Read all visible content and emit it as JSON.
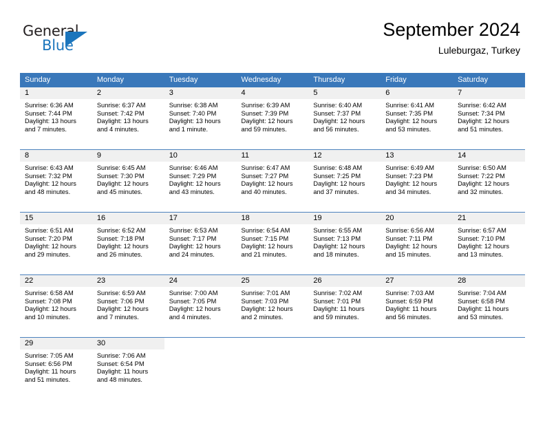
{
  "brand": {
    "name_part1": "General",
    "name_part2": "Blue",
    "logo_icon": "triangle-flag-icon",
    "color_primary": "#1b75bc",
    "color_text": "#231f20"
  },
  "header": {
    "title": "September 2024",
    "subtitle": "Luleburgaz, Turkey"
  },
  "theme": {
    "header_row_bg": "#3a78ba",
    "daynum_bar_bg": "#f0f0f0",
    "week_separator": "#4a81bd",
    "page_bg": "#ffffff"
  },
  "weekday_headers": [
    "Sunday",
    "Monday",
    "Tuesday",
    "Wednesday",
    "Thursday",
    "Friday",
    "Saturday"
  ],
  "weeks": [
    [
      {
        "day": "1",
        "sunrise": "Sunrise: 6:36 AM",
        "sunset": "Sunset: 7:44 PM",
        "daylight_line1": "Daylight: 13 hours",
        "daylight_line2": "and 7 minutes."
      },
      {
        "day": "2",
        "sunrise": "Sunrise: 6:37 AM",
        "sunset": "Sunset: 7:42 PM",
        "daylight_line1": "Daylight: 13 hours",
        "daylight_line2": "and 4 minutes."
      },
      {
        "day": "3",
        "sunrise": "Sunrise: 6:38 AM",
        "sunset": "Sunset: 7:40 PM",
        "daylight_line1": "Daylight: 13 hours",
        "daylight_line2": "and 1 minute."
      },
      {
        "day": "4",
        "sunrise": "Sunrise: 6:39 AM",
        "sunset": "Sunset: 7:39 PM",
        "daylight_line1": "Daylight: 12 hours",
        "daylight_line2": "and 59 minutes."
      },
      {
        "day": "5",
        "sunrise": "Sunrise: 6:40 AM",
        "sunset": "Sunset: 7:37 PM",
        "daylight_line1": "Daylight: 12 hours",
        "daylight_line2": "and 56 minutes."
      },
      {
        "day": "6",
        "sunrise": "Sunrise: 6:41 AM",
        "sunset": "Sunset: 7:35 PM",
        "daylight_line1": "Daylight: 12 hours",
        "daylight_line2": "and 53 minutes."
      },
      {
        "day": "7",
        "sunrise": "Sunrise: 6:42 AM",
        "sunset": "Sunset: 7:34 PM",
        "daylight_line1": "Daylight: 12 hours",
        "daylight_line2": "and 51 minutes."
      }
    ],
    [
      {
        "day": "8",
        "sunrise": "Sunrise: 6:43 AM",
        "sunset": "Sunset: 7:32 PM",
        "daylight_line1": "Daylight: 12 hours",
        "daylight_line2": "and 48 minutes."
      },
      {
        "day": "9",
        "sunrise": "Sunrise: 6:45 AM",
        "sunset": "Sunset: 7:30 PM",
        "daylight_line1": "Daylight: 12 hours",
        "daylight_line2": "and 45 minutes."
      },
      {
        "day": "10",
        "sunrise": "Sunrise: 6:46 AM",
        "sunset": "Sunset: 7:29 PM",
        "daylight_line1": "Daylight: 12 hours",
        "daylight_line2": "and 43 minutes."
      },
      {
        "day": "11",
        "sunrise": "Sunrise: 6:47 AM",
        "sunset": "Sunset: 7:27 PM",
        "daylight_line1": "Daylight: 12 hours",
        "daylight_line2": "and 40 minutes."
      },
      {
        "day": "12",
        "sunrise": "Sunrise: 6:48 AM",
        "sunset": "Sunset: 7:25 PM",
        "daylight_line1": "Daylight: 12 hours",
        "daylight_line2": "and 37 minutes."
      },
      {
        "day": "13",
        "sunrise": "Sunrise: 6:49 AM",
        "sunset": "Sunset: 7:23 PM",
        "daylight_line1": "Daylight: 12 hours",
        "daylight_line2": "and 34 minutes."
      },
      {
        "day": "14",
        "sunrise": "Sunrise: 6:50 AM",
        "sunset": "Sunset: 7:22 PM",
        "daylight_line1": "Daylight: 12 hours",
        "daylight_line2": "and 32 minutes."
      }
    ],
    [
      {
        "day": "15",
        "sunrise": "Sunrise: 6:51 AM",
        "sunset": "Sunset: 7:20 PM",
        "daylight_line1": "Daylight: 12 hours",
        "daylight_line2": "and 29 minutes."
      },
      {
        "day": "16",
        "sunrise": "Sunrise: 6:52 AM",
        "sunset": "Sunset: 7:18 PM",
        "daylight_line1": "Daylight: 12 hours",
        "daylight_line2": "and 26 minutes."
      },
      {
        "day": "17",
        "sunrise": "Sunrise: 6:53 AM",
        "sunset": "Sunset: 7:17 PM",
        "daylight_line1": "Daylight: 12 hours",
        "daylight_line2": "and 24 minutes."
      },
      {
        "day": "18",
        "sunrise": "Sunrise: 6:54 AM",
        "sunset": "Sunset: 7:15 PM",
        "daylight_line1": "Daylight: 12 hours",
        "daylight_line2": "and 21 minutes."
      },
      {
        "day": "19",
        "sunrise": "Sunrise: 6:55 AM",
        "sunset": "Sunset: 7:13 PM",
        "daylight_line1": "Daylight: 12 hours",
        "daylight_line2": "and 18 minutes."
      },
      {
        "day": "20",
        "sunrise": "Sunrise: 6:56 AM",
        "sunset": "Sunset: 7:11 PM",
        "daylight_line1": "Daylight: 12 hours",
        "daylight_line2": "and 15 minutes."
      },
      {
        "day": "21",
        "sunrise": "Sunrise: 6:57 AM",
        "sunset": "Sunset: 7:10 PM",
        "daylight_line1": "Daylight: 12 hours",
        "daylight_line2": "and 13 minutes."
      }
    ],
    [
      {
        "day": "22",
        "sunrise": "Sunrise: 6:58 AM",
        "sunset": "Sunset: 7:08 PM",
        "daylight_line1": "Daylight: 12 hours",
        "daylight_line2": "and 10 minutes."
      },
      {
        "day": "23",
        "sunrise": "Sunrise: 6:59 AM",
        "sunset": "Sunset: 7:06 PM",
        "daylight_line1": "Daylight: 12 hours",
        "daylight_line2": "and 7 minutes."
      },
      {
        "day": "24",
        "sunrise": "Sunrise: 7:00 AM",
        "sunset": "Sunset: 7:05 PM",
        "daylight_line1": "Daylight: 12 hours",
        "daylight_line2": "and 4 minutes."
      },
      {
        "day": "25",
        "sunrise": "Sunrise: 7:01 AM",
        "sunset": "Sunset: 7:03 PM",
        "daylight_line1": "Daylight: 12 hours",
        "daylight_line2": "and 2 minutes."
      },
      {
        "day": "26",
        "sunrise": "Sunrise: 7:02 AM",
        "sunset": "Sunset: 7:01 PM",
        "daylight_line1": "Daylight: 11 hours",
        "daylight_line2": "and 59 minutes."
      },
      {
        "day": "27",
        "sunrise": "Sunrise: 7:03 AM",
        "sunset": "Sunset: 6:59 PM",
        "daylight_line1": "Daylight: 11 hours",
        "daylight_line2": "and 56 minutes."
      },
      {
        "day": "28",
        "sunrise": "Sunrise: 7:04 AM",
        "sunset": "Sunset: 6:58 PM",
        "daylight_line1": "Daylight: 11 hours",
        "daylight_line2": "and 53 minutes."
      }
    ],
    [
      {
        "day": "29",
        "sunrise": "Sunrise: 7:05 AM",
        "sunset": "Sunset: 6:56 PM",
        "daylight_line1": "Daylight: 11 hours",
        "daylight_line2": "and 51 minutes."
      },
      {
        "day": "30",
        "sunrise": "Sunrise: 7:06 AM",
        "sunset": "Sunset: 6:54 PM",
        "daylight_line1": "Daylight: 11 hours",
        "daylight_line2": "and 48 minutes."
      },
      {
        "day": "",
        "sunrise": "",
        "sunset": "",
        "daylight_line1": "",
        "daylight_line2": ""
      },
      {
        "day": "",
        "sunrise": "",
        "sunset": "",
        "daylight_line1": "",
        "daylight_line2": ""
      },
      {
        "day": "",
        "sunrise": "",
        "sunset": "",
        "daylight_line1": "",
        "daylight_line2": ""
      },
      {
        "day": "",
        "sunrise": "",
        "sunset": "",
        "daylight_line1": "",
        "daylight_line2": ""
      },
      {
        "day": "",
        "sunrise": "",
        "sunset": "",
        "daylight_line1": "",
        "daylight_line2": ""
      }
    ]
  ]
}
